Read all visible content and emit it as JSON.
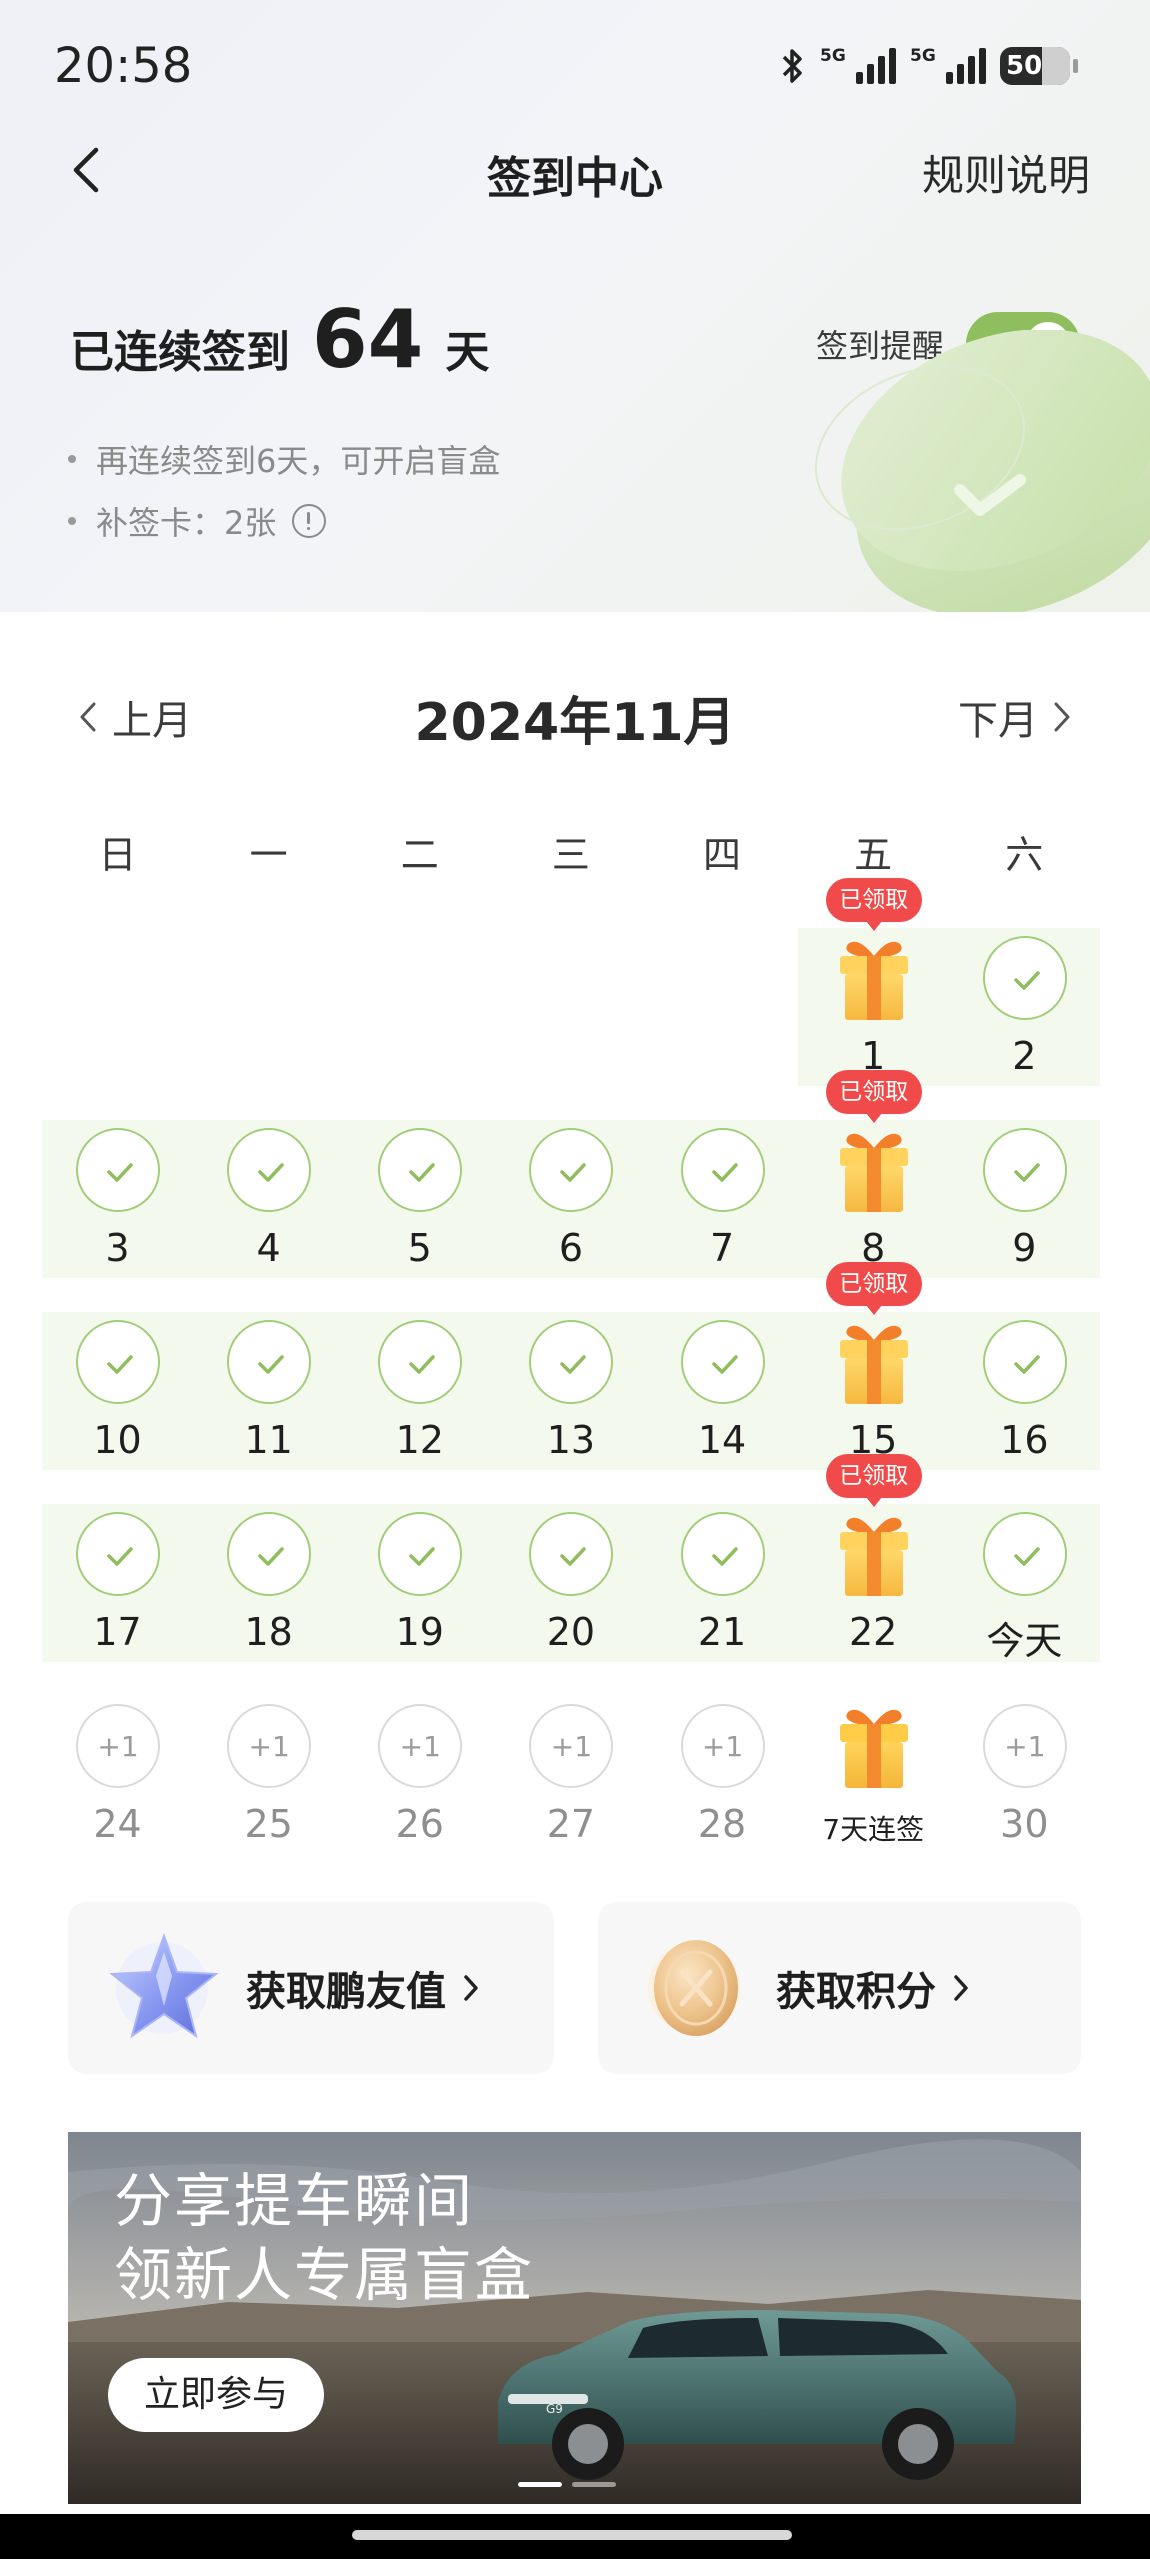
{
  "status_bar": {
    "time": "20:58",
    "signal1_label": "5G",
    "signal2_label": "5G",
    "battery": "50",
    "icons": [
      "bluetooth-icon",
      "signal-icon",
      "signal-icon",
      "battery-icon"
    ]
  },
  "nav": {
    "back_icon": "chevron-left-icon",
    "title": "签到中心",
    "rules": "规则说明"
  },
  "summary": {
    "streak_prefix": "已连续签到",
    "streak_days": "64",
    "streak_suffix": "天",
    "reminder_label": "签到提醒",
    "reminder_on": true,
    "note1": "再连续签到6天，可开启盲盒",
    "note2": "补签卡：2张",
    "accent_color": "#8fbe5f"
  },
  "calendar": {
    "prev": "上月",
    "title": "2024年11月",
    "next": "下月",
    "weekdays": [
      "日",
      "一",
      "二",
      "三",
      "四",
      "五",
      "六"
    ],
    "claimed_label": "已领取",
    "today_label": "今天",
    "bonus_label": "7天连签",
    "plus_label": "+1",
    "days": [
      {
        "label": "1",
        "state": "gift-claimed"
      },
      {
        "label": "2",
        "state": "checked"
      },
      {
        "label": "3",
        "state": "checked"
      },
      {
        "label": "4",
        "state": "checked"
      },
      {
        "label": "5",
        "state": "checked"
      },
      {
        "label": "6",
        "state": "checked"
      },
      {
        "label": "7",
        "state": "checked"
      },
      {
        "label": "8",
        "state": "gift-claimed"
      },
      {
        "label": "9",
        "state": "checked"
      },
      {
        "label": "10",
        "state": "checked"
      },
      {
        "label": "11",
        "state": "checked"
      },
      {
        "label": "12",
        "state": "checked"
      },
      {
        "label": "13",
        "state": "checked"
      },
      {
        "label": "14",
        "state": "checked"
      },
      {
        "label": "15",
        "state": "gift-claimed"
      },
      {
        "label": "16",
        "state": "checked"
      },
      {
        "label": "17",
        "state": "checked"
      },
      {
        "label": "18",
        "state": "checked"
      },
      {
        "label": "19",
        "state": "checked"
      },
      {
        "label": "20",
        "state": "checked"
      },
      {
        "label": "21",
        "state": "checked"
      },
      {
        "label": "22",
        "state": "gift-claimed"
      },
      {
        "label": "今天",
        "state": "checked"
      },
      {
        "label": "24",
        "state": "future"
      },
      {
        "label": "25",
        "state": "future"
      },
      {
        "label": "26",
        "state": "future"
      },
      {
        "label": "27",
        "state": "future"
      },
      {
        "label": "28",
        "state": "future"
      },
      {
        "label": "7天连签",
        "state": "gift-future"
      },
      {
        "label": "30",
        "state": "future"
      }
    ]
  },
  "actions": {
    "friend_points": "获取鹏友值",
    "points": "获取积分"
  },
  "banner": {
    "line1": "分享提车瞬间",
    "line2": "领新人专属盲盒",
    "button": "立即参与",
    "car_badge": "G9"
  }
}
